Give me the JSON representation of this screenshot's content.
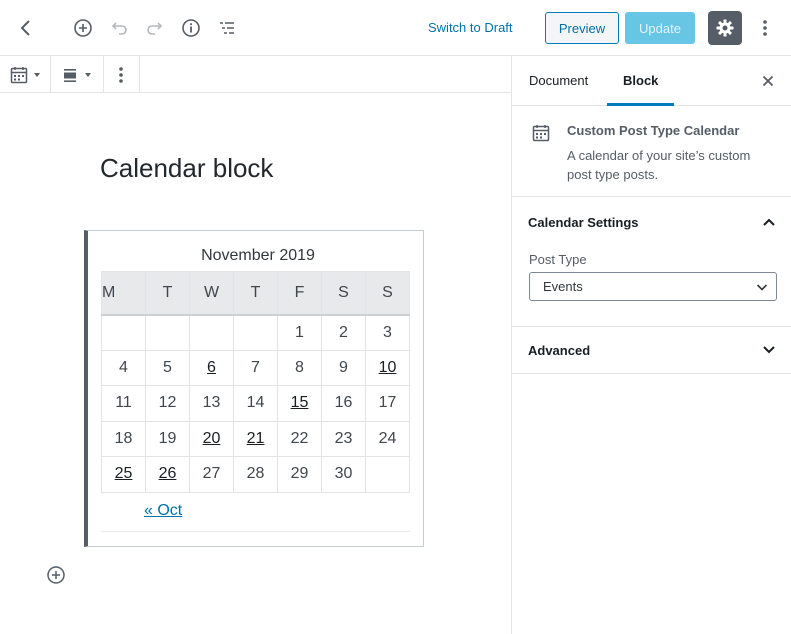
{
  "header": {
    "switch_to_draft": "Switch to Draft",
    "preview": "Preview",
    "update": "Update",
    "icons": [
      "back-chevron-icon",
      "add-block-icon",
      "undo-icon",
      "redo-icon",
      "info-icon",
      "outline-icon",
      "gear-icon",
      "more-vertical-icon"
    ]
  },
  "block_toolbar": {
    "icons": [
      "calendar-icon",
      "caret-down-icon",
      "align-icon",
      "caret-down-icon",
      "more-vertical-icon"
    ]
  },
  "editor": {
    "block_title": "Calendar block",
    "calendar": {
      "caption": "November 2019",
      "weekdays": [
        "M",
        "T",
        "W",
        "T",
        "F",
        "S",
        "S"
      ],
      "weeks": [
        [
          "",
          "",
          "",
          "",
          "1",
          "2",
          "3"
        ],
        [
          "4",
          "5",
          "6",
          "7",
          "8",
          "9",
          "10"
        ],
        [
          "11",
          "12",
          "13",
          "14",
          "15",
          "16",
          "17"
        ],
        [
          "18",
          "19",
          "20",
          "21",
          "22",
          "23",
          "24"
        ],
        [
          "25",
          "26",
          "27",
          "28",
          "29",
          "30",
          ""
        ]
      ],
      "linked_days": [
        "6",
        "10",
        "15",
        "20",
        "21",
        "25",
        "26"
      ],
      "prev_link": "« Oct"
    }
  },
  "sidebar": {
    "tabs": [
      {
        "label": "Document",
        "active": false
      },
      {
        "label": "Block",
        "active": true
      }
    ],
    "block_card": {
      "title": "Custom Post Type Calendar",
      "description": "A calendar of your site’s custom post type posts."
    },
    "calendar_settings": {
      "title": "Calendar Settings",
      "post_type_label": "Post Type",
      "post_type_value": "Events"
    },
    "advanced": {
      "title": "Advanced"
    }
  },
  "colors": {
    "accent": "#007cba",
    "link": "#0073aa",
    "update_disabled": "#66c6e4",
    "settings_bg": "#555d66"
  }
}
